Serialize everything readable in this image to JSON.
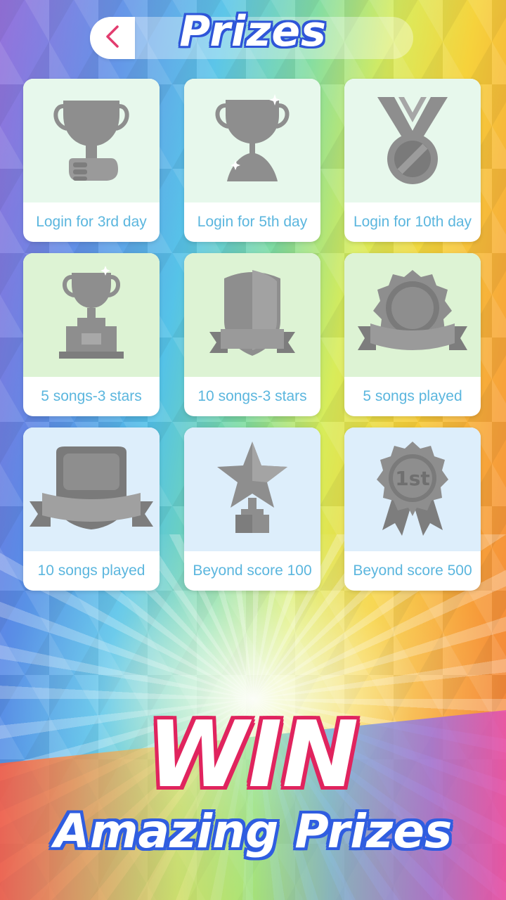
{
  "header": {
    "title": "Prizes",
    "back_icon": "chevron-left-icon"
  },
  "prizes": [
    {
      "label": "Login for 3rd day",
      "icon": "trophy-hand-icon"
    },
    {
      "label": "Login for 5th day",
      "icon": "hourglass-trophy-icon"
    },
    {
      "label": "Login for 10th day",
      "icon": "medal-icon"
    },
    {
      "label": "5 songs-3 stars",
      "icon": "trophy-pedestal-icon"
    },
    {
      "label": "10 songs-3 stars",
      "icon": "shield-banner-icon"
    },
    {
      "label": "5 songs played",
      "icon": "rosette-banner-icon"
    },
    {
      "label": "10 songs played",
      "icon": "plaque-banner-icon"
    },
    {
      "label": "Beyond score 100",
      "icon": "star-trophy-icon"
    },
    {
      "label": "Beyond score 500",
      "icon": "first-place-badge-icon"
    }
  ],
  "promo": {
    "headline": "WIN",
    "subline": "Amazing Prizes"
  },
  "colors": {
    "label_text": "#5bb6de",
    "icon_gray": "#8e8e8e",
    "title_outline": "#2e55d8",
    "win_outline": "#e0245e"
  }
}
